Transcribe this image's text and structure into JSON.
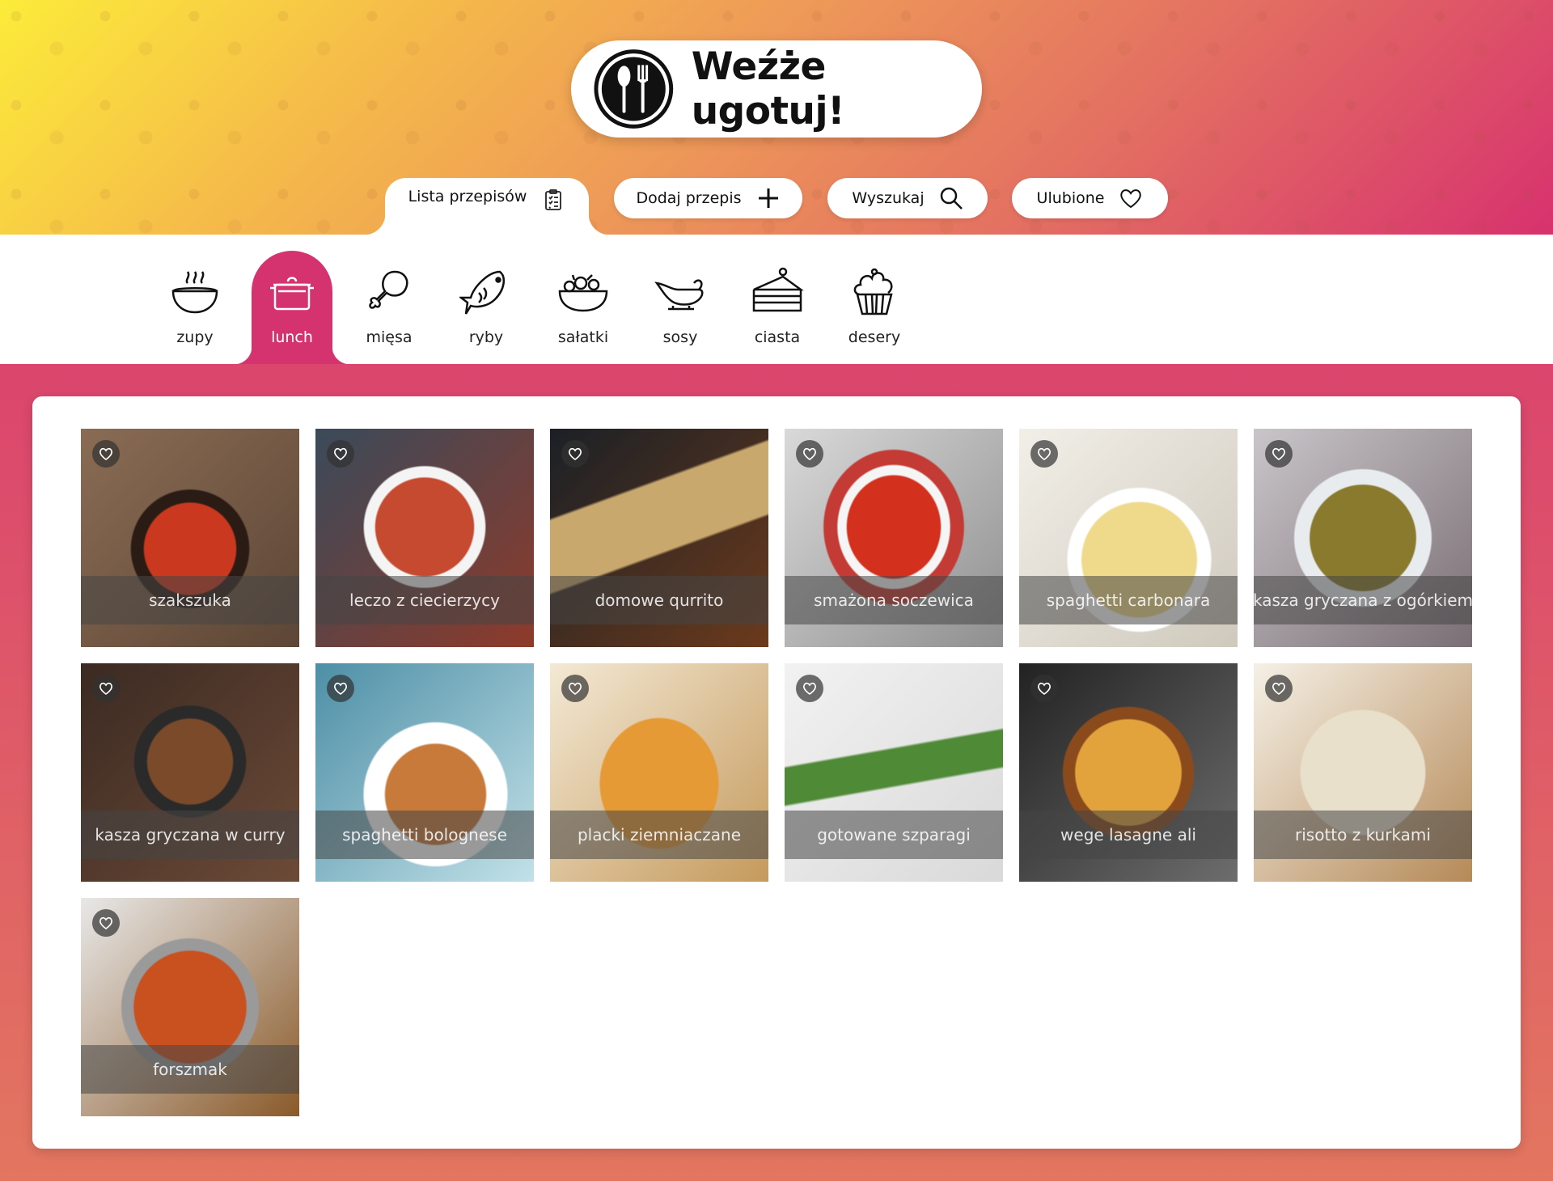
{
  "app": {
    "title": "Weźże ugotuj!"
  },
  "nav": [
    {
      "label": "Lista przepisów",
      "icon": "clipboard-list-icon",
      "active": true
    },
    {
      "label": "Dodaj przepis",
      "icon": "plus-icon",
      "active": false
    },
    {
      "label": "Wyszukaj",
      "icon": "search-icon",
      "active": false
    },
    {
      "label": "Ulubione",
      "icon": "heart-icon",
      "active": false
    }
  ],
  "categories": [
    {
      "label": "zupy",
      "icon": "soup-bowl-icon",
      "active": false
    },
    {
      "label": "lunch",
      "icon": "pot-icon",
      "active": true
    },
    {
      "label": "mięsa",
      "icon": "drumstick-icon",
      "active": false
    },
    {
      "label": "ryby",
      "icon": "fish-icon",
      "active": false
    },
    {
      "label": "sałatki",
      "icon": "salad-bowl-icon",
      "active": false
    },
    {
      "label": "sosy",
      "icon": "gravy-boat-icon",
      "active": false
    },
    {
      "label": "ciasta",
      "icon": "cake-slice-icon",
      "active": false
    },
    {
      "label": "desery",
      "icon": "cupcake-icon",
      "active": false
    }
  ],
  "recipes": [
    {
      "title": "szakszuka"
    },
    {
      "title": "leczo z ciecierzycy"
    },
    {
      "title": "domowe qurrito"
    },
    {
      "title": "smażona soczewica"
    },
    {
      "title": "spaghetti carbonara"
    },
    {
      "title": "kasza gryczana z ogórkiem"
    },
    {
      "title": "kasza gryczana w curry"
    },
    {
      "title": "spaghetti bolognese"
    },
    {
      "title": "placki ziemniaczane"
    },
    {
      "title": "gotowane szparagi"
    },
    {
      "title": "wege lasagne ali"
    },
    {
      "title": "risotto z kurkami"
    },
    {
      "title": "forszmak"
    }
  ],
  "colors": {
    "accent": "#d4336f",
    "header_start": "#fcec3a",
    "header_end": "#d7326e"
  }
}
